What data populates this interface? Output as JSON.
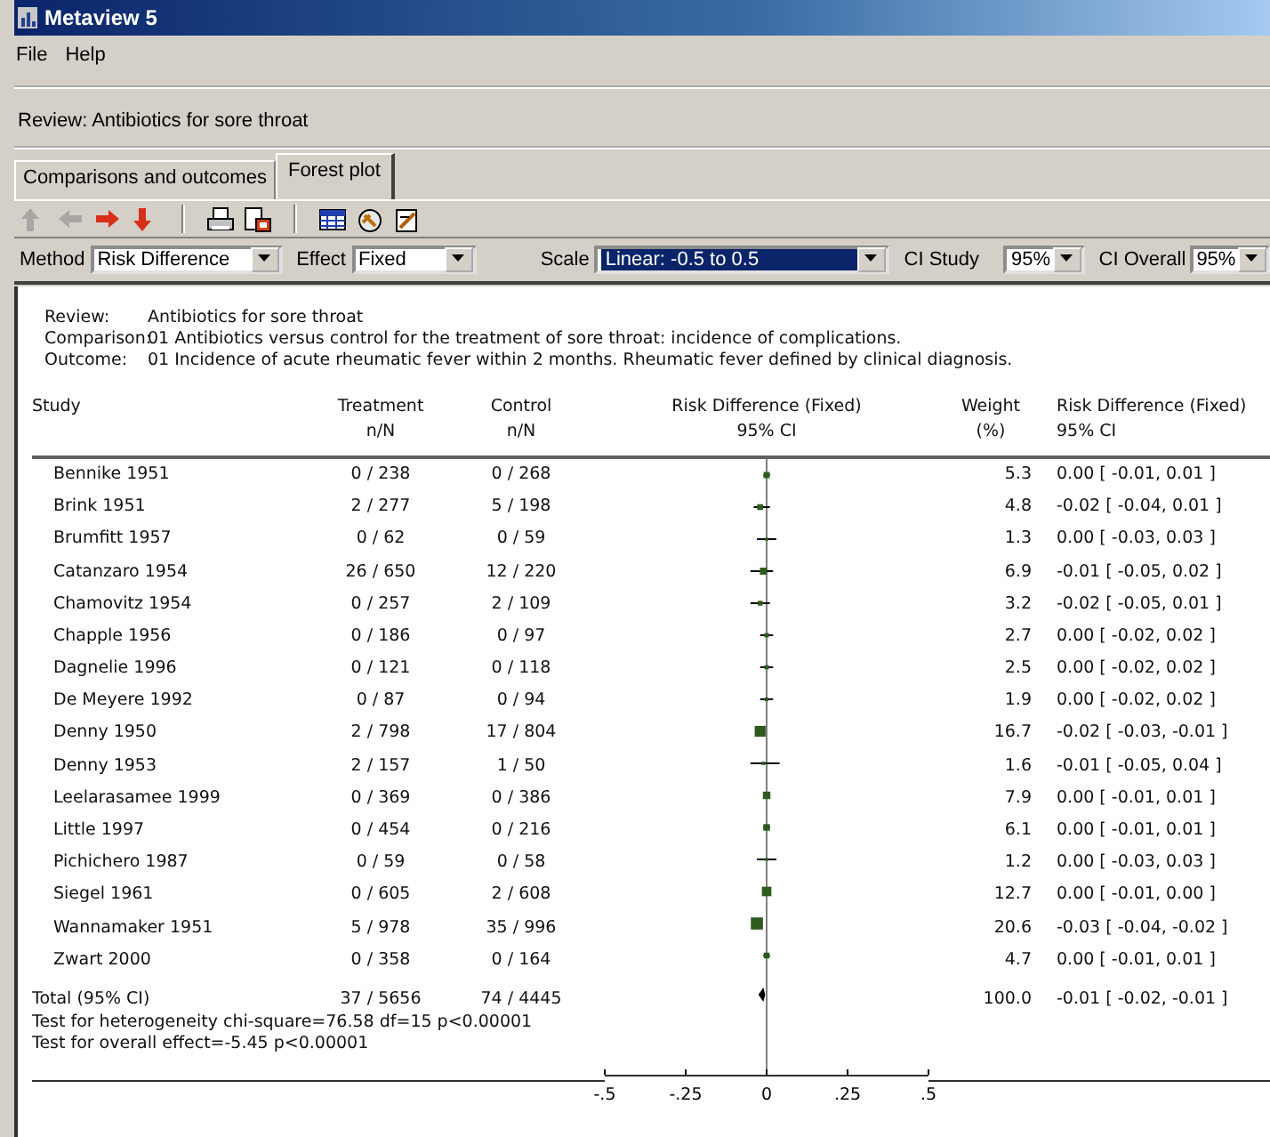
{
  "window": {
    "title": "Metaview 5"
  },
  "menu": [
    "File",
    "Help"
  ],
  "review_bar": "Review: Antibiotics for sore throat",
  "tabs": [
    {
      "label": "Comparisons and outcomes",
      "selected": false
    },
    {
      "label": "Forest plot",
      "selected": true
    }
  ],
  "toolbar": [
    {
      "kind": "arrow-up",
      "disabled": true
    },
    {
      "kind": "arrow-left",
      "disabled": true
    },
    {
      "kind": "arrow-right",
      "disabled": false
    },
    {
      "kind": "arrow-down",
      "disabled": false
    },
    {
      "kind": "separator"
    },
    {
      "kind": "print"
    },
    {
      "kind": "preview"
    },
    {
      "kind": "separator"
    },
    {
      "kind": "grid"
    },
    {
      "kind": "wizard"
    },
    {
      "kind": "edit"
    }
  ],
  "options": [
    {
      "label": "Method",
      "value": "Risk Difference",
      "highlighted": false
    },
    {
      "label": "Effect",
      "value": "Fixed",
      "highlighted": false
    },
    {
      "label": "Scale",
      "value": "Linear:  -0.5 to 0.5",
      "highlighted": true
    },
    {
      "label": "CI Study",
      "value": "95%",
      "highlighted": false
    },
    {
      "label": "CI Overall",
      "value": "95%",
      "highlighted": false
    }
  ],
  "info": [
    {
      "label": "Review:",
      "text": "Antibiotics for sore throat"
    },
    {
      "label": "Comparison:",
      "text": "01 Antibiotics versus control for the treatment of sore throat: incidence of complications."
    },
    {
      "label": "Outcome:",
      "text": "01 Incidence of acute rheumatic fever within 2 months. Rheumatic fever defined by clinical diagnosis."
    }
  ],
  "columns": [
    {
      "line1": "Study"
    },
    {
      "line1": "Treatment",
      "line2": "n/N"
    },
    {
      "line1": "Control",
      "line2": "n/N"
    },
    {
      "line1": "Risk Difference (Fixed)",
      "line2": "95% CI"
    },
    {
      "line1": "Weight",
      "line2": "(%)"
    },
    {
      "line1": "Risk Difference (Fixed)",
      "line2": "95% CI"
    }
  ],
  "rows": [
    {
      "kind": "study",
      "study": "Bennike 1951",
      "treatment": "0 / 238",
      "control": "0 / 268",
      "weight": "5.3",
      "ci": "0.00 [ -0.01, 0.01 ]"
    },
    {
      "kind": "study",
      "study": "Brink 1951",
      "treatment": "2 / 277",
      "control": "5 / 198",
      "weight": "4.8",
      "ci": "-0.02 [ -0.04, 0.01 ]"
    },
    {
      "kind": "study",
      "study": "Brumfitt 1957",
      "treatment": "0 / 62",
      "control": "0 / 59",
      "weight": "1.3",
      "ci": "0.00 [ -0.03, 0.03 ]"
    },
    {
      "kind": "study",
      "study": "Catanzaro 1954",
      "treatment": "26 / 650",
      "control": "12 / 220",
      "weight": "6.9",
      "ci": "-0.01 [ -0.05, 0.02 ]"
    },
    {
      "kind": "study",
      "study": "Chamovitz 1954",
      "treatment": "0 / 257",
      "control": "2 / 109",
      "weight": "3.2",
      "ci": "-0.02 [ -0.05, 0.01 ]"
    },
    {
      "kind": "study",
      "study": "Chapple 1956",
      "treatment": "0 / 186",
      "control": "0 / 97",
      "weight": "2.7",
      "ci": "0.00 [ -0.02, 0.02 ]"
    },
    {
      "kind": "study",
      "study": "Dagnelie 1996",
      "treatment": "0 / 121",
      "control": "0 / 118",
      "weight": "2.5",
      "ci": "0.00 [ -0.02, 0.02 ]"
    },
    {
      "kind": "study",
      "study": "De Meyere 1992",
      "treatment": "0 / 87",
      "control": "0 / 94",
      "weight": "1.9",
      "ci": "0.00 [ -0.02, 0.02 ]"
    },
    {
      "kind": "study",
      "study": "Denny 1950",
      "treatment": "2 / 798",
      "control": "17 / 804",
      "weight": "16.7",
      "ci": "-0.02 [ -0.03, -0.01 ]"
    },
    {
      "kind": "study",
      "study": "Denny 1953",
      "treatment": "2 / 157",
      "control": "1 / 50",
      "weight": "1.6",
      "ci": "-0.01 [ -0.05, 0.04 ]"
    },
    {
      "kind": "study",
      "study": "Leelarasamee 1999",
      "treatment": "0 / 369",
      "control": "0 / 386",
      "weight": "7.9",
      "ci": "0.00 [ -0.01, 0.01 ]"
    },
    {
      "kind": "study",
      "study": "Little 1997",
      "treatment": "0 / 454",
      "control": "0 / 216",
      "weight": "6.1",
      "ci": "0.00 [ -0.01, 0.01 ]"
    },
    {
      "kind": "study",
      "study": "Pichichero 1987",
      "treatment": "0 / 59",
      "control": "0 / 58",
      "weight": "1.2",
      "ci": "0.00 [ -0.03, 0.03 ]"
    },
    {
      "kind": "study",
      "study": "Siegel 1961",
      "treatment": "0 / 605",
      "control": "2 / 608",
      "weight": "12.7",
      "ci": "0.00 [ -0.01, 0.00 ]"
    },
    {
      "kind": "study",
      "study": "Wannamaker 1951",
      "treatment": "5 / 978",
      "control": "35 / 996",
      "weight": "20.6",
      "ci": "-0.03 [ -0.04, -0.02 ]"
    },
    {
      "kind": "study",
      "study": "Zwart 2000",
      "treatment": "0 / 358",
      "control": "0 / 164",
      "weight": "4.7",
      "ci": "0.00 [ -0.01, 0.01 ]"
    },
    {
      "kind": "total",
      "study": "Total (95% CI)",
      "treatment": "37 / 5656",
      "control": "74 / 4445",
      "weight": "100.0",
      "ci": "-0.01 [ -0.02, -0.01 ]"
    }
  ],
  "tests": [
    "Test for heterogeneity chi-square=76.58 df=15 p<0.00001",
    "Test for overall effect=-5.45 p<0.00001"
  ],
  "plot_axis": {
    "tick_labels": [
      "-.5",
      "-.25",
      "0",
      ".25",
      ".5"
    ]
  }
}
